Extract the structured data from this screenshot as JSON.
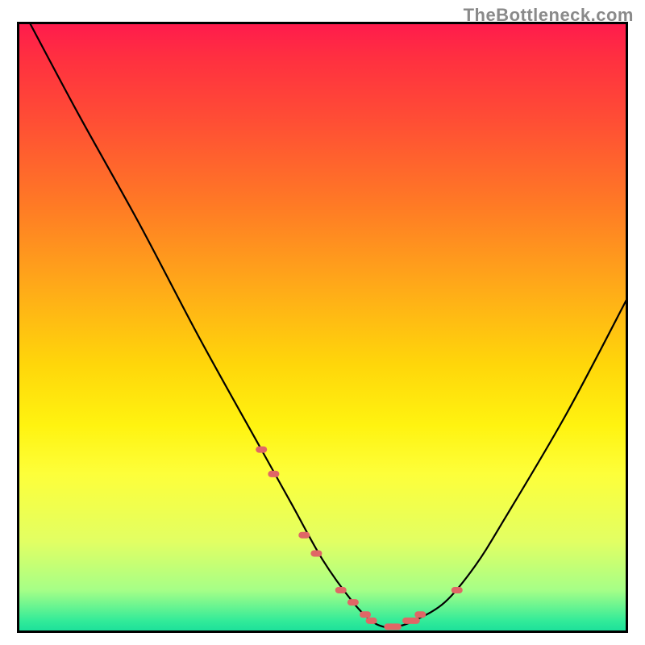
{
  "watermark": "TheBottleneck.com",
  "chart_data": {
    "type": "line",
    "title": "",
    "xlabel": "",
    "ylabel": "",
    "xlim": [
      0,
      100
    ],
    "ylim": [
      0,
      100
    ],
    "series": [
      {
        "name": "curve",
        "x": [
          2,
          10,
          20,
          30,
          40,
          45,
          50,
          55,
          58,
          60,
          62,
          65,
          70,
          75,
          80,
          90,
          100
        ],
        "y": [
          100,
          85,
          67,
          48,
          30,
          21,
          12,
          5,
          2,
          1,
          1,
          2,
          5,
          11,
          19,
          36,
          55
        ]
      }
    ],
    "markers": {
      "name": "highlight",
      "color": "#e06666",
      "x": [
        40,
        42,
        47,
        49,
        53,
        55,
        57,
        58,
        61,
        62,
        64,
        65,
        66,
        72
      ],
      "y": [
        30,
        26,
        16,
        13,
        7,
        5,
        3,
        2,
        1,
        1,
        2,
        2,
        3,
        7
      ]
    },
    "gradient_stops": [
      {
        "pos": 0,
        "color": "#ff1a4d"
      },
      {
        "pos": 30,
        "color": "#ff7a25"
      },
      {
        "pos": 60,
        "color": "#ffe610"
      },
      {
        "pos": 85,
        "color": "#e2ff63"
      },
      {
        "pos": 100,
        "color": "#18de9a"
      }
    ]
  }
}
